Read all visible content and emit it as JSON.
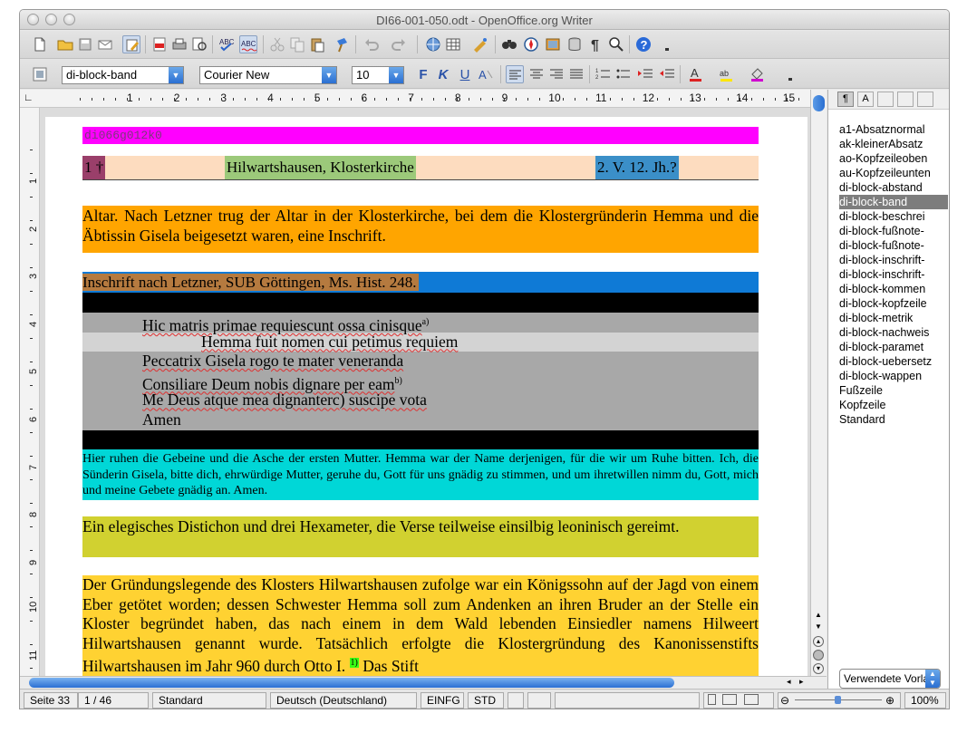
{
  "window": {
    "title": "DI66-001-050.odt - OpenOffice.org Writer"
  },
  "toolbar1": {
    "icons": [
      "new-document",
      "open-folder",
      "save",
      "email",
      "edit-mode",
      "export-pdf",
      "print",
      "page-preview",
      "spellcheck",
      "autospellcheck",
      "cut",
      "copy",
      "paste",
      "clone-format",
      "undo",
      "redo",
      "hyperlink",
      "table",
      "show-draw-functions",
      "find-replace",
      "navigator",
      "gallery",
      "data-sources",
      "nonprinting-characters",
      "zoom",
      "help"
    ]
  },
  "toolbar2": {
    "paragraph_style": "di-block-band",
    "font_name": "Courier New",
    "font_size": "10",
    "bold": "F",
    "italic": "K",
    "underline": "U"
  },
  "ruler": {
    "numbers": [
      "1",
      "2",
      "3",
      "4",
      "5",
      "6",
      "7",
      "8",
      "9",
      "10",
      "11",
      "12",
      "13",
      "14",
      "15"
    ]
  },
  "vruler": {
    "numbers": [
      "1",
      "2",
      "3",
      "4",
      "5",
      "6",
      "7",
      "8",
      "9",
      "10",
      "11"
    ]
  },
  "document": {
    "band_id": "di066g012k0",
    "header": {
      "number": "1 †",
      "location": "Hilwartshausen, Klosterkirche",
      "date": "2. V. 12. Jh.?"
    },
    "intro": "Altar. Nach Letzner trug der Altar in der Klosterkirche, bei dem die Klostergründerin Hemma und die Äbtissin Gisela beigesetzt waren, eine Inschrift.",
    "source": "Inschrift nach Letzner, SUB Göttingen, Ms. Hist. 248.",
    "verses": [
      {
        "text": "Hic matris primae requiescunt ossa cinisque",
        "sup": "a)"
      },
      {
        "text": "Hemma fuit nomen cui petimus requiem",
        "sup": ""
      },
      {
        "text": "Peccatrix Gisela rogo te mater veneranda",
        "sup": ""
      },
      {
        "text": "Consiliare Deum nobis dignare per eam",
        "sup": "b)"
      },
      {
        "text": "Me Deus atque mea dignanterc) suscipe vota",
        "sup": ""
      },
      {
        "text": "Amen",
        "sup": ""
      }
    ],
    "translation": "Hier ruhen die Gebeine und die Asche der ersten Mutter. Hemma war der Name derjenigen, für die wir um Ruhe bitten. Ich, die Sünderin Gisela, bitte dich, ehrwürdige Mutter, geruhe du, Gott für uns gnädig zu stimmen, und um ihretwillen nimm du, Gott, mich und meine Gebete gnädig an. Amen.",
    "metrics": "Ein elegisches Distichon und drei Hexameter, die Verse teilweise einsilbig leoninisch gereimt.",
    "commentary": "Der Gründungslegende des Klosters Hilwartshausen zufolge war ein Königssohn auf der Jagd von einem Eber getötet worden; dessen Schwester Hemma soll zum Andenken an ihren Bruder an der Stelle ein Kloster begründet haben, das nach einem in dem Wald lebenden Einsiedler namens Hilweert Hilwartshausen genannt wurde. Tatsächlich erfolgte die Klostergründung des Kanonissenstifts Hilwartshausen im Jahr 960 durch Otto I.",
    "commentary_note": "1)",
    "commentary_tail": "Das Stift"
  },
  "colors": {
    "band": "#ff00ff",
    "header_bg": "#fddcbf",
    "header_number": "#9a3f6a",
    "header_location": "#9cc97a",
    "header_date": "#3b8fc8",
    "intro": "#ffa500",
    "source_a": "#b57a3f",
    "source_b": "#0f7ad6",
    "verse_dark": "#a8a8a8",
    "verse_light": "#d3d3d3",
    "translation": "#00d7d7",
    "metrics": "#d1d130",
    "commentary": "#ffd232",
    "footnote_mark": "#39ff14"
  },
  "stylist": {
    "styles": [
      "a1-Absatznormal",
      "ak-kleinerAbsatz",
      "ao-Kopfzeileoben",
      "au-Kopfzeileunten",
      "di-block-abstand",
      "di-block-band",
      "di-block-beschrei",
      "di-block-fußnote-",
      "di-block-fußnote-",
      "di-block-inschrift-",
      "di-block-inschrift-",
      "di-block-kommen",
      "di-block-kopfzeile",
      "di-block-metrik",
      "di-block-nachweis",
      "di-block-paramet",
      "di-block-uebersetz",
      "di-block-wappen",
      "Fußzeile",
      "Kopfzeile",
      "Standard"
    ],
    "selected": "di-block-band",
    "filter": "Verwendete Vorlagen"
  },
  "status": {
    "page": "Seite 33",
    "count": "1 / 46",
    "page_style": "Standard",
    "language": "Deutsch (Deutschland)",
    "insert": "EINFG",
    "selection": "STD",
    "zoom": "100%"
  }
}
